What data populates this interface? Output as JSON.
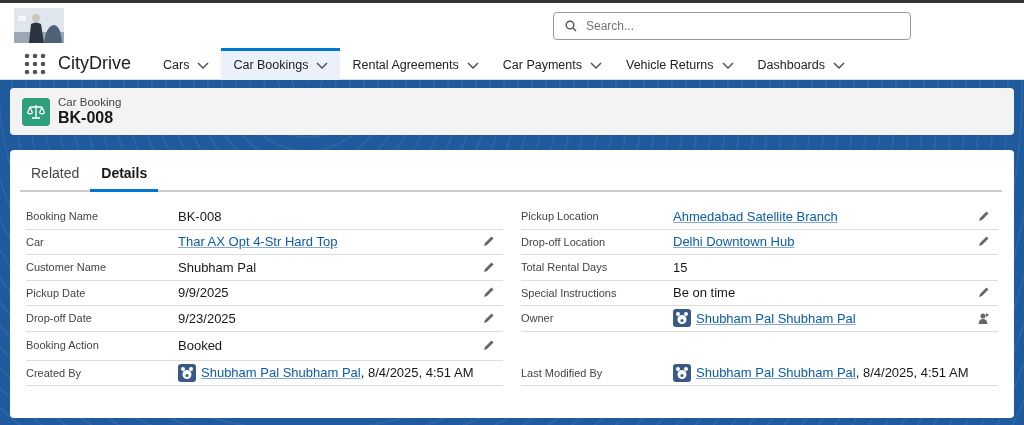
{
  "app": {
    "name": "CityDrive"
  },
  "search": {
    "placeholder": "Search..."
  },
  "nav": [
    {
      "label": "Cars",
      "selected": false
    },
    {
      "label": "Car Bookings",
      "selected": true
    },
    {
      "label": "Rental Agreements",
      "selected": false
    },
    {
      "label": "Car Payments",
      "selected": false
    },
    {
      "label": "Vehicle Returns",
      "selected": false
    },
    {
      "label": "Dashboards",
      "selected": false
    }
  ],
  "record": {
    "object": "Car Booking",
    "title": "BK-008"
  },
  "tabs": [
    {
      "label": "Related",
      "selected": false
    },
    {
      "label": "Details",
      "selected": true
    }
  ],
  "columns": [
    [
      {
        "label": "Booking Name",
        "kind": "text",
        "value": "BK-008",
        "editable": false
      },
      {
        "label": "Car",
        "kind": "link",
        "value": "Thar AX Opt 4-Str Hard Top",
        "editable": true
      },
      {
        "label": "Customer Name",
        "kind": "text",
        "value": "Shubham Pal",
        "editable": true
      },
      {
        "label": "Pickup Date",
        "kind": "text",
        "value": "9/9/2025",
        "editable": true
      },
      {
        "label": "Drop-off Date",
        "kind": "text",
        "value": "9/23/2025",
        "editable": true
      },
      {
        "label": "Booking Action",
        "kind": "text",
        "value": "Booked",
        "editable": true
      },
      {
        "label": "Created By",
        "kind": "user",
        "value": "Shubham Pal Shubham Pal",
        "suffix": ", 8/4/2025, 4:51 AM",
        "editable": false
      }
    ],
    [
      {
        "label": "Pickup Location",
        "kind": "link",
        "value": "Ahmedabad Satellite Branch",
        "editable": true
      },
      {
        "label": "Drop-off Location",
        "kind": "link",
        "value": "Delhi Downtown Hub",
        "editable": true
      },
      {
        "label": "Total Rental Days",
        "kind": "text",
        "value": "15",
        "editable": false
      },
      {
        "label": "Special Instructions",
        "kind": "text",
        "value": "Be on time",
        "editable": true
      },
      {
        "label": "Owner",
        "kind": "owner",
        "value": "Shubham Pal Shubham Pal",
        "editable": true
      },
      {
        "label": "Last Modified By",
        "kind": "user",
        "value": "Shubham Pal Shubham Pal",
        "suffix": ", 8/4/2025, 4:51 AM",
        "editable": false
      }
    ]
  ]
}
